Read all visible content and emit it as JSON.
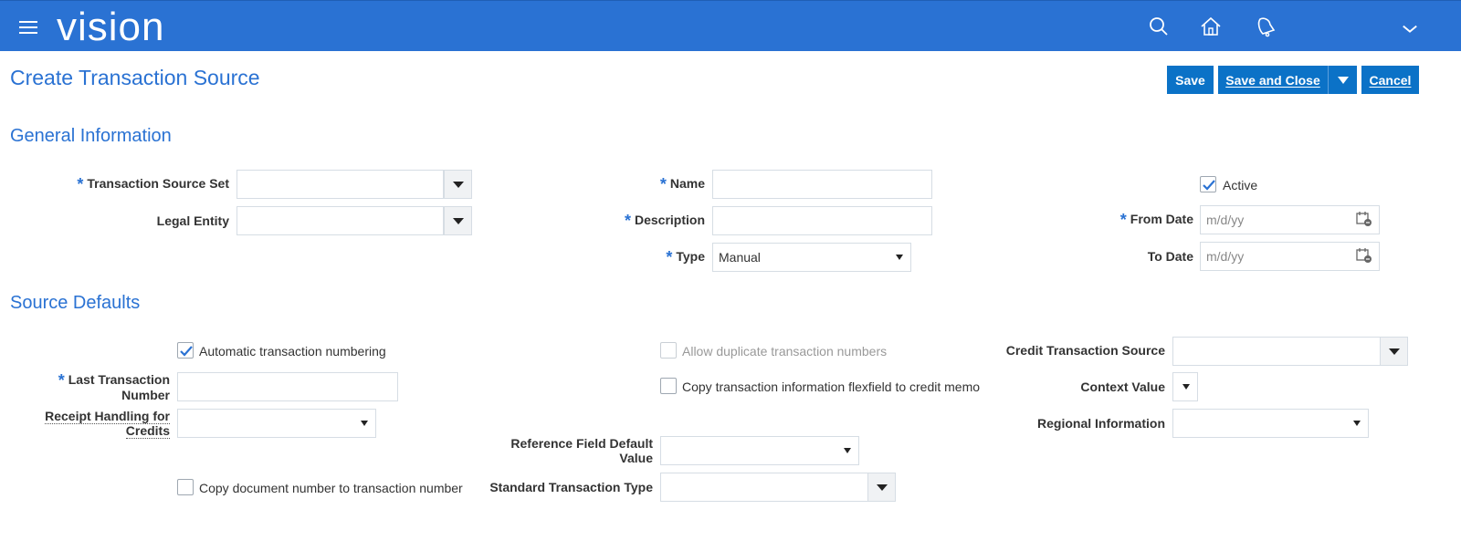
{
  "header": {
    "brand": "vision",
    "icons": [
      "menu-icon",
      "search-icon",
      "home-icon",
      "notifications-icon",
      "chevron-down-icon"
    ]
  },
  "page": {
    "title": "Create Transaction Source",
    "buttons": {
      "save": "Save",
      "save_and_close": "Save and Close",
      "cancel": "Cancel"
    }
  },
  "general": {
    "title": "General Information",
    "transaction_source_set": {
      "label": "Transaction Source Set",
      "value": ""
    },
    "legal_entity": {
      "label": "Legal Entity",
      "value": ""
    },
    "name": {
      "label": "Name",
      "value": ""
    },
    "description": {
      "label": "Description",
      "value": ""
    },
    "type": {
      "label": "Type",
      "value": "Manual"
    },
    "active": {
      "label": "Active",
      "checked": true
    },
    "from_date": {
      "label": "From Date",
      "placeholder": "m/d/yy"
    },
    "to_date": {
      "label": "To Date",
      "placeholder": "m/d/yy"
    }
  },
  "defaults": {
    "title": "Source Defaults",
    "auto_numbering": {
      "label": "Automatic transaction numbering",
      "checked": true
    },
    "last_transaction_number": {
      "label_line1": "Last Transaction",
      "label_line2": "Number",
      "value": ""
    },
    "receipt_handling": {
      "label_line1": "Receipt Handling for",
      "label_line2": "Credits",
      "value": ""
    },
    "copy_doc_number": {
      "label": "Copy document number to transaction number",
      "checked": false
    },
    "allow_duplicate": {
      "label": "Allow duplicate transaction numbers",
      "checked": false,
      "disabled": true
    },
    "copy_flexfield": {
      "label": "Copy transaction information flexfield to credit memo",
      "checked": false
    },
    "reference_field": {
      "label_line1": "Reference Field Default",
      "label_line2": "Value",
      "value": ""
    },
    "standard_transaction_type": {
      "label": "Standard Transaction Type",
      "value": ""
    },
    "credit_transaction_source": {
      "label": "Credit Transaction Source",
      "value": ""
    },
    "context_value": {
      "label": "Context Value",
      "value": ""
    },
    "regional_information": {
      "label": "Regional Information",
      "value": ""
    }
  },
  "colors": {
    "header_bg": "#2a72d3",
    "accent": "#2a72d3",
    "button_bg": "#0b72c7"
  }
}
